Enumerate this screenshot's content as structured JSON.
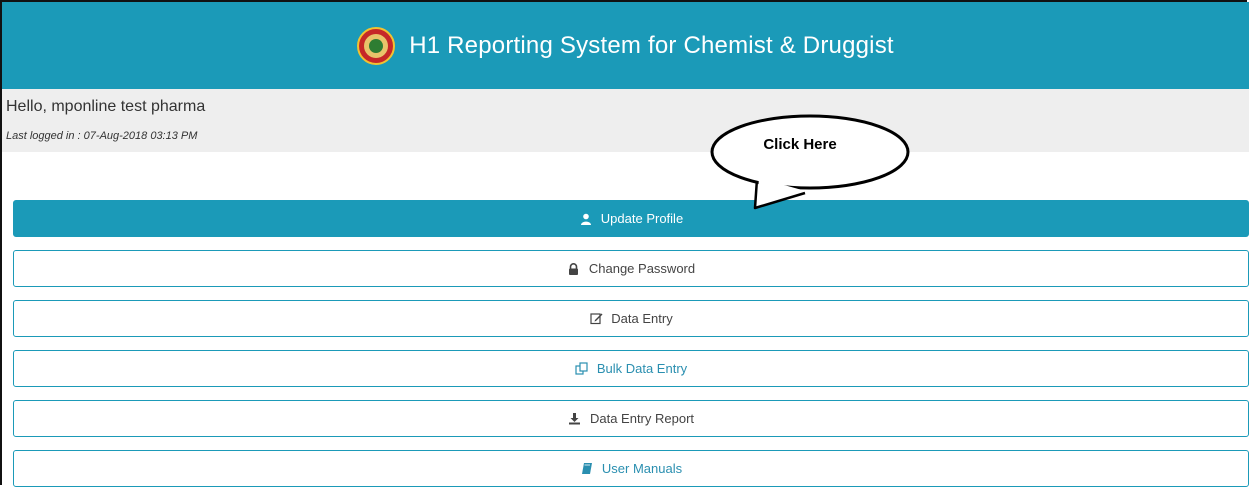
{
  "header": {
    "title": "H1 Reporting System for Chemist & Druggist",
    "logo_icon": "emblem-logo-icon",
    "background": "#1b9ab8"
  },
  "user": {
    "greeting": "Hello, mponline test pharma",
    "last_login": "Last logged in : 07-Aug-2018 03:13 PM"
  },
  "callout": {
    "text": "Click Here"
  },
  "menu": {
    "items": [
      {
        "label": "Update Profile",
        "icon": "user-icon",
        "active": true
      },
      {
        "label": "Change Password",
        "icon": "lock-icon"
      },
      {
        "label": "Data Entry",
        "icon": "edit-icon"
      },
      {
        "label": "Bulk Data Entry",
        "icon": "copy-icon"
      },
      {
        "label": "Data Entry Report",
        "icon": "download-icon"
      },
      {
        "label": "User Manuals",
        "icon": "book-icon"
      }
    ]
  }
}
